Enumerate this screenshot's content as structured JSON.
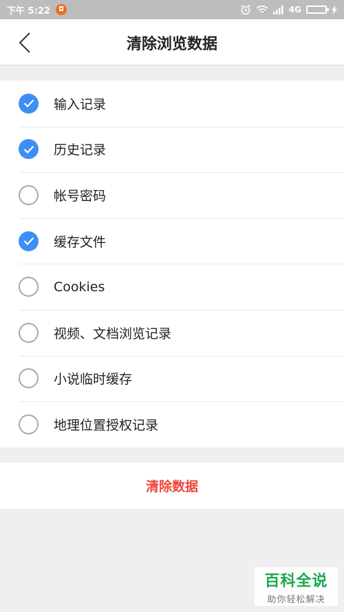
{
  "status_bar": {
    "time": "下午 5:22",
    "network": "4G",
    "icons": [
      "app-notification-icon",
      "alarm-icon",
      "wifi-icon",
      "signal-icon",
      "battery-icon",
      "charging-icon"
    ]
  },
  "header": {
    "title": "清除浏览数据",
    "back_icon": "chevron-left-icon"
  },
  "options": [
    {
      "label": "输入记录",
      "checked": true
    },
    {
      "label": "历史记录",
      "checked": true
    },
    {
      "label": "帐号密码",
      "checked": false
    },
    {
      "label": "缓存文件",
      "checked": true
    },
    {
      "label": "Cookies",
      "checked": false
    },
    {
      "label": "视频、文档浏览记录",
      "checked": false
    },
    {
      "label": "小说临时缓存",
      "checked": false
    },
    {
      "label": "地理位置授权记录",
      "checked": false
    }
  ],
  "action": {
    "label": "清除数据"
  },
  "watermark": {
    "title": "百科全说",
    "subtitle": "助你轻松解决"
  },
  "colors": {
    "accent": "#3d8ff5",
    "danger": "#f0453a",
    "brand": "#1aa84a"
  }
}
